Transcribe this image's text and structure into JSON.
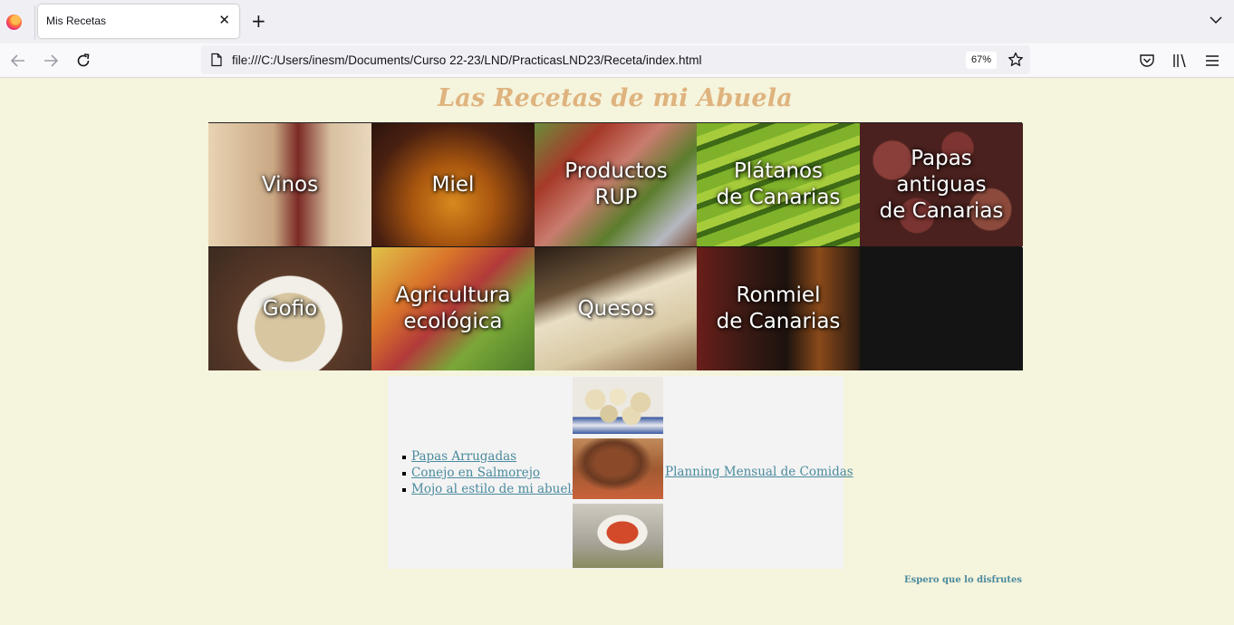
{
  "browser": {
    "tab_title": "Mis Recetas",
    "tab_close": "✕",
    "new_tab": "+",
    "url": "file:///C:/Users/inesm/Documents/Curso 22-23/LND/PracticasLND23/Receta/index.html",
    "zoom": "67%"
  },
  "page": {
    "title": "Las Recetas de mi Abuela",
    "categories": [
      {
        "label": "Vinos",
        "theme": "wine"
      },
      {
        "label": "Miel",
        "theme": "honey"
      },
      {
        "label": "Productos\nRUP",
        "theme": "produce"
      },
      {
        "label": "Plátanos\nde Canarias",
        "theme": "bananas"
      },
      {
        "label": "Papas\nantiguas\nde Canarias",
        "theme": "potatoes"
      },
      {
        "label": "Gofio",
        "theme": "gofio"
      },
      {
        "label": "Agricultura\necológica",
        "theme": "mangoes"
      },
      {
        "label": "Quesos",
        "theme": "cheese"
      },
      {
        "label": "Ronmiel\nde Canarias",
        "theme": "rum"
      },
      {
        "label": "",
        "theme": "empty"
      }
    ],
    "recipes": [
      {
        "label": "Papas Arrugadas"
      },
      {
        "label": "Conejo en Salmorejo"
      },
      {
        "label": "Mojo al estilo de mi abuela"
      }
    ],
    "planning_link": "Planning Mensual de Comidas",
    "footer": "Espero que lo disfrutes"
  },
  "colors": {
    "page_background": "#f5f4dc",
    "title": "#dfb37e",
    "link": "#4a8a9e",
    "recipes_box": "#f3f3f3"
  }
}
